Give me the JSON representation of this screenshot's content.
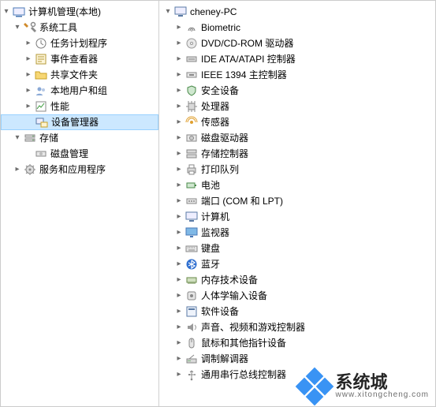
{
  "left": {
    "root": "计算机管理(本地)",
    "system_tools": "系统工具",
    "task_scheduler": "任务计划程序",
    "event_viewer": "事件查看器",
    "shared_folders": "共享文件夹",
    "local_users": "本地用户和组",
    "performance": "性能",
    "device_manager": "设备管理器",
    "storage": "存储",
    "disk_management": "磁盘管理",
    "services_apps": "服务和应用程序"
  },
  "right": {
    "computer": "cheney-PC",
    "items": [
      {
        "icon": "biometric",
        "label": "Biometric"
      },
      {
        "icon": "disc",
        "label": "DVD/CD-ROM 驱动器"
      },
      {
        "icon": "ide",
        "label": "IDE ATA/ATAPI 控制器"
      },
      {
        "icon": "ieee",
        "label": "IEEE 1394 主控制器"
      },
      {
        "icon": "security",
        "label": "安全设备"
      },
      {
        "icon": "cpu",
        "label": "处理器"
      },
      {
        "icon": "sensor",
        "label": "传感器"
      },
      {
        "icon": "disk",
        "label": "磁盘驱动器"
      },
      {
        "icon": "storage-ctrl",
        "label": "存储控制器"
      },
      {
        "icon": "print",
        "label": "打印队列"
      },
      {
        "icon": "battery",
        "label": "电池"
      },
      {
        "icon": "port",
        "label": "端口 (COM 和 LPT)"
      },
      {
        "icon": "computer",
        "label": "计算机"
      },
      {
        "icon": "monitor",
        "label": "监视器"
      },
      {
        "icon": "keyboard",
        "label": "键盘"
      },
      {
        "icon": "bluetooth",
        "label": "蓝牙"
      },
      {
        "icon": "memory",
        "label": "内存技术设备"
      },
      {
        "icon": "hid",
        "label": "人体学输入设备"
      },
      {
        "icon": "software",
        "label": "软件设备"
      },
      {
        "icon": "sound",
        "label": "声音、视频和游戏控制器"
      },
      {
        "icon": "mouse",
        "label": "鼠标和其他指针设备"
      },
      {
        "icon": "modem",
        "label": "调制解调器"
      },
      {
        "icon": "usb",
        "label": "通用串行总线控制器"
      }
    ]
  },
  "watermark": {
    "main": "系统城",
    "sub": "www.xitongcheng.com"
  }
}
